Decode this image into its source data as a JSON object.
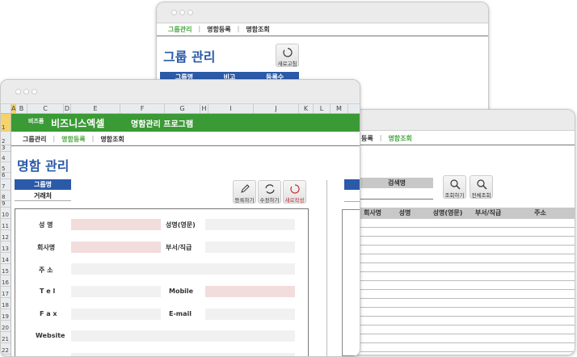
{
  "nav": {
    "group": "그룹관리",
    "register": "명함등록",
    "search": "명함조회",
    "sep": "|"
  },
  "group_window": {
    "title": "그룹 관리",
    "refresh_label": "새로고침",
    "table_headers": [
      "그룹명",
      "비고",
      "등록수"
    ]
  },
  "search_window": {
    "nav_partial": "등록",
    "search_label": "검색명",
    "search_value": "",
    "search_button": "조회하기",
    "all_button": "전체조회",
    "table_headers": [
      "회사명",
      "성명",
      "성명(영문)",
      "부서/직급",
      "주소"
    ]
  },
  "main_window": {
    "columns": [
      "A",
      "B",
      "C",
      "D",
      "E",
      "F",
      "G",
      "H",
      "I",
      "J",
      "K",
      "L",
      "M"
    ],
    "rows": [
      "1",
      "2",
      "3",
      "4",
      "5",
      "6",
      "7",
      "8",
      "9",
      "10",
      "11",
      "12",
      "13",
      "14",
      "15",
      "16",
      "17",
      "18",
      "19",
      "20",
      "21",
      "22"
    ],
    "brand_small": "비즈폼",
    "brand": "비즈니스엑셀",
    "program": "명함관리 프로그램",
    "title": "명함 관리",
    "group_label": "그룹명",
    "group_value": "거래처",
    "buttons": {
      "register": "등록하기",
      "edit": "수정하기",
      "new": "새로작성"
    },
    "form": {
      "name": "성 명",
      "name_en": "성명(영문)",
      "company": "회사명",
      "dept": "부서/직급",
      "address": "주 소",
      "tel": "T e l",
      "mobile": "Mobile",
      "fax": "F a x",
      "email": "E-mail",
      "website": "Website"
    }
  },
  "colors": {
    "green": "#3a9a35",
    "blue": "#2b5aa8",
    "accent_green": "#4aa842",
    "required": "#f2dcdc"
  }
}
